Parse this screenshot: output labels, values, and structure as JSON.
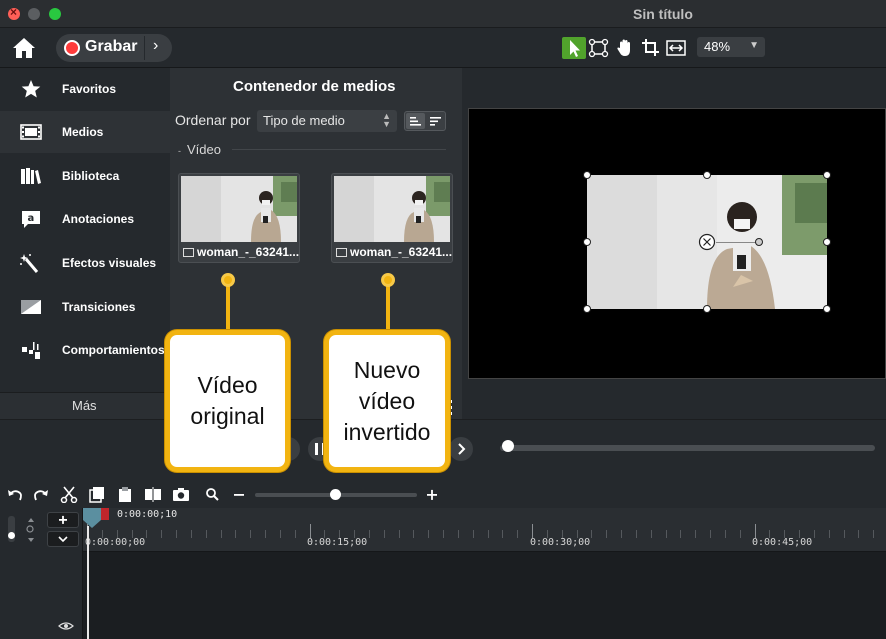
{
  "window": {
    "title": "Sin título"
  },
  "toolbar": {
    "record_label": "Grabar",
    "zoom_value": "48%",
    "tools": [
      "cursor-tool-icon",
      "edit-points-icon",
      "pan-hand-icon",
      "crop-icon",
      "fit-canvas-icon"
    ]
  },
  "sidebar": {
    "items": [
      {
        "label": "Favoritos",
        "icon": "star-icon"
      },
      {
        "label": "Medios",
        "icon": "film-icon"
      },
      {
        "label": "Biblioteca",
        "icon": "library-icon"
      },
      {
        "label": "Anotaciones",
        "icon": "annotation-icon"
      },
      {
        "label": "Efectos visuales",
        "icon": "magic-wand-icon"
      },
      {
        "label": "Transiciones",
        "icon": "transition-icon"
      },
      {
        "label": "Comportamientos",
        "icon": "behaviors-icon"
      }
    ],
    "more_label": "Más"
  },
  "media_bin": {
    "title": "Contenedor de medios",
    "sort_label": "Ordenar por",
    "sort_value": "Tipo de medio",
    "group_label": "Vídeo",
    "items": [
      {
        "name": "woman_-_63241..."
      },
      {
        "name": "woman_-_63241..."
      }
    ]
  },
  "timeline": {
    "playhead_time": "0:00:00;10",
    "time_labels": [
      "0:00:00;00",
      "0:00:15;00",
      "0:00:30;00",
      "0:00:45;00"
    ]
  },
  "callouts": [
    {
      "text": "Vídeo\noriginal"
    },
    {
      "text": "Nuevo\nvídeo\ninvertido"
    }
  ],
  "colors": {
    "accent": "#51a32c",
    "callout": "#f2b411",
    "record": "#ff3b3b"
  }
}
